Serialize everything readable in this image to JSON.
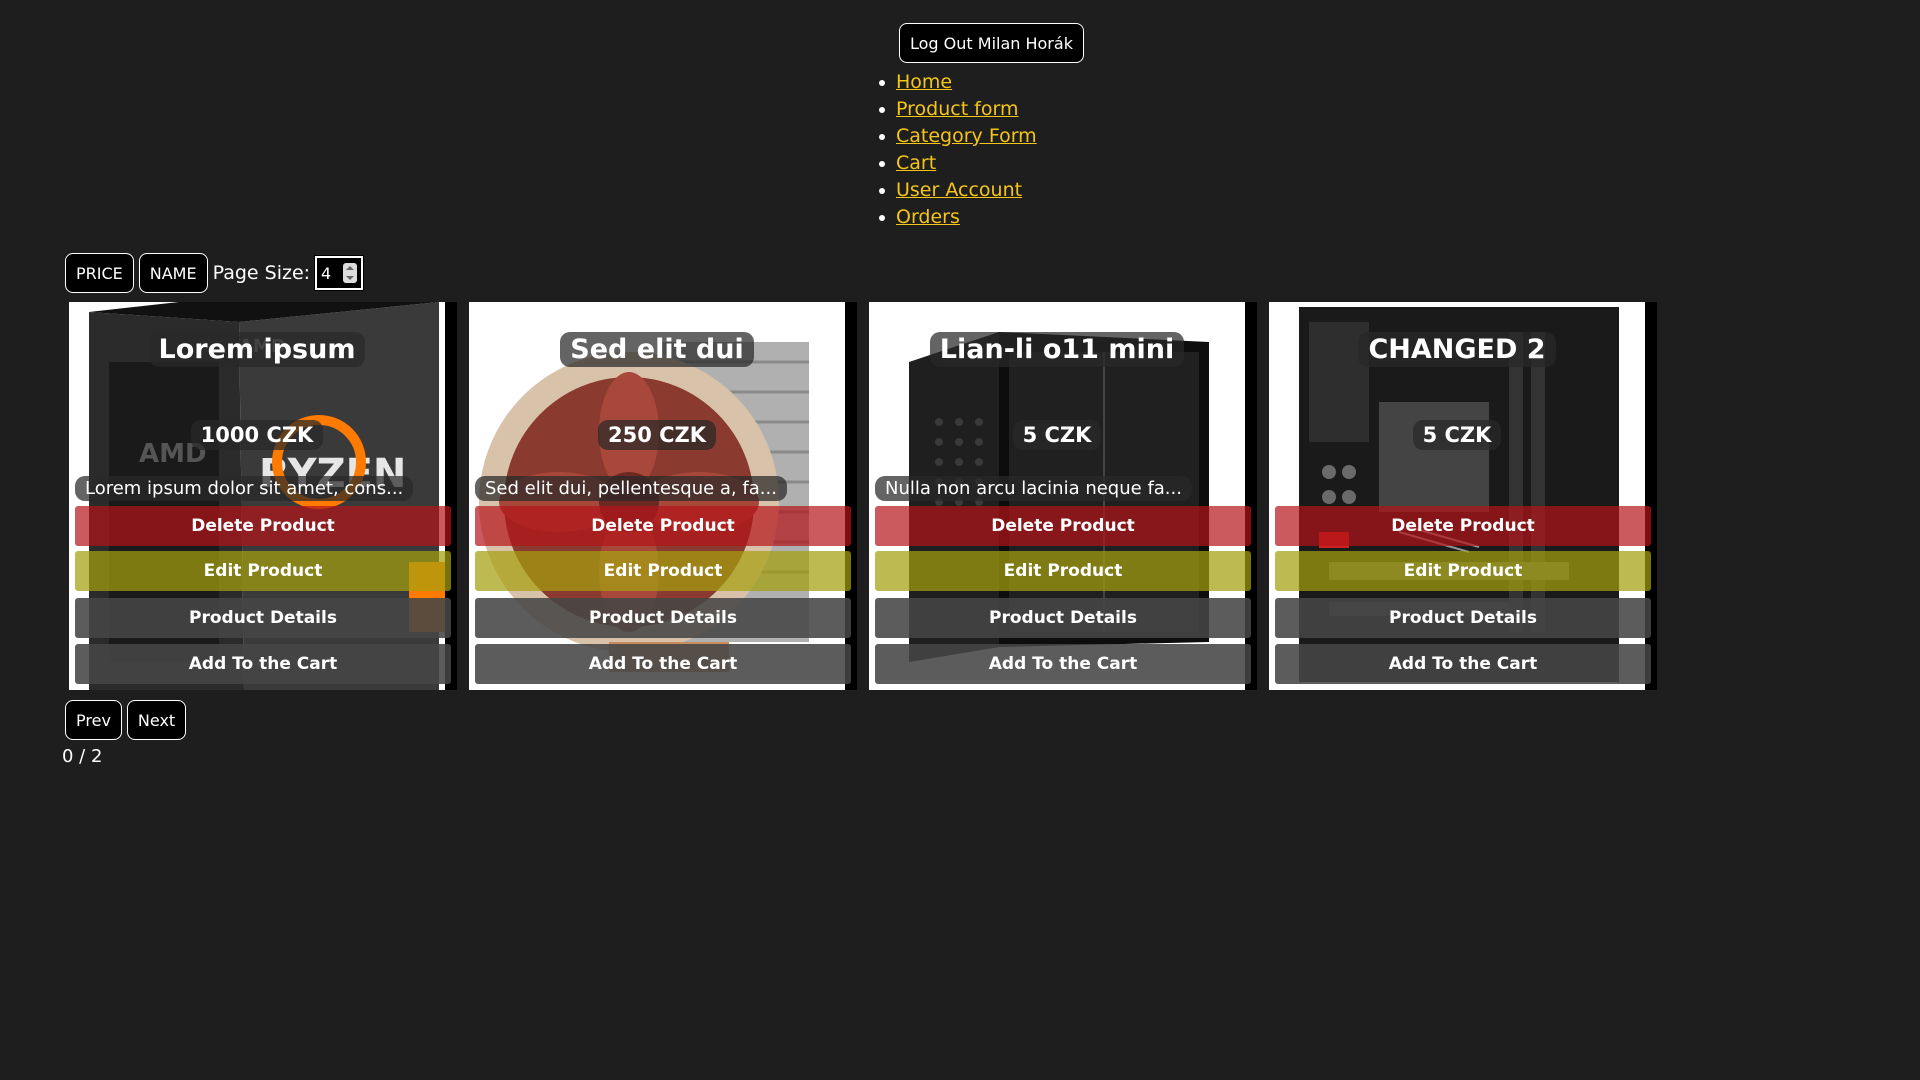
{
  "header": {
    "logout_label": "Log Out Milan Horák"
  },
  "nav": {
    "items": [
      "Home",
      "Product form",
      "Category Form",
      "Cart",
      "User Account",
      "Orders"
    ]
  },
  "controls": {
    "price_label": "PRICE",
    "name_label": "NAME",
    "page_size_label": "Page Size:",
    "page_size_value": "4"
  },
  "products": [
    {
      "title": "Lorem ipsum",
      "price": "1000 CZK",
      "description": "Lorem ipsum dolor sit amet, cons...",
      "image": "amd-ryzen-box"
    },
    {
      "title": "Sed elit dui",
      "price": "250 CZK",
      "description": "Sed elit dui, pellentesque a, fa...",
      "image": "cpu-cooler-fan"
    },
    {
      "title": "Lian-li o11 mini",
      "price": "5 CZK",
      "description": "Nulla non arcu lacinia neque fa...",
      "image": "pc-case"
    },
    {
      "title": "CHANGED 2",
      "price": "5 CZK",
      "description": "",
      "image": "motherboard"
    }
  ],
  "card_actions": {
    "delete": "Delete Product",
    "edit": "Edit Product",
    "details": "Product Details",
    "cart": "Add To the Cart"
  },
  "pagination": {
    "prev_label": "Prev",
    "next_label": "Next",
    "page_info": "0 / 2"
  },
  "colors": {
    "background": "#1e1e1e",
    "link": "#f5c518",
    "delete": "#b41419",
    "edit": "#a5a00f",
    "neutral": "#464646"
  }
}
